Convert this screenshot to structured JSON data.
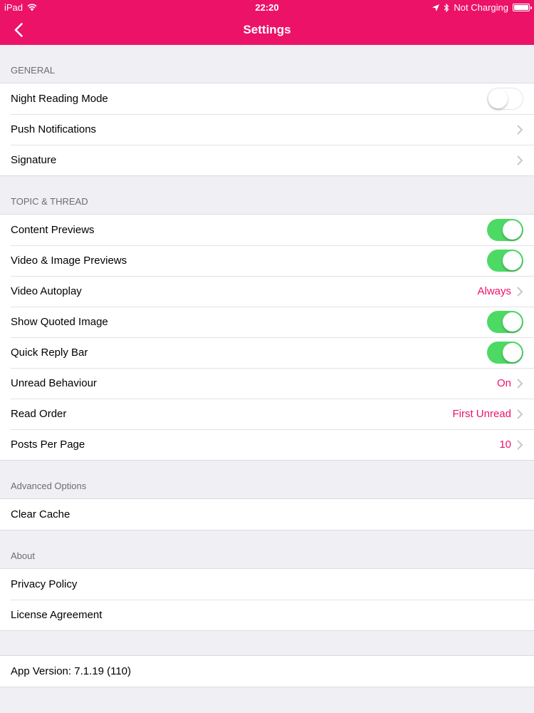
{
  "status_bar": {
    "device": "iPad",
    "time": "22:20",
    "charging": "Not Charging"
  },
  "nav": {
    "title": "Settings"
  },
  "colors": {
    "brand": "#ec1268",
    "toggle_on": "#4cd964"
  },
  "sections": {
    "general": {
      "header": "GENERAL",
      "rows": {
        "night_reading": {
          "label": "Night Reading Mode",
          "toggle": "off"
        },
        "push": {
          "label": "Push Notifications"
        },
        "signature": {
          "label": "Signature"
        }
      }
    },
    "topic": {
      "header": "TOPIC & THREAD",
      "rows": {
        "content_previews": {
          "label": "Content Previews",
          "toggle": "on"
        },
        "video_image_previews": {
          "label": "Video & Image Previews",
          "toggle": "on"
        },
        "video_autoplay": {
          "label": "Video Autoplay",
          "value": "Always"
        },
        "show_quoted_image": {
          "label": "Show Quoted Image",
          "toggle": "on"
        },
        "quick_reply_bar": {
          "label": "Quick Reply Bar",
          "toggle": "on"
        },
        "unread_behaviour": {
          "label": "Unread Behaviour",
          "value": "On"
        },
        "read_order": {
          "label": "Read Order",
          "value": "First Unread"
        },
        "posts_per_page": {
          "label": "Posts Per Page",
          "value": "10"
        }
      }
    },
    "advanced": {
      "header": "Advanced Options",
      "rows": {
        "clear_cache": {
          "label": "Clear Cache"
        }
      }
    },
    "about": {
      "header": "About",
      "rows": {
        "privacy": {
          "label": "Privacy Policy"
        },
        "license": {
          "label": "License Agreement"
        }
      }
    },
    "version": {
      "label": "App Version: 7.1.19 (110)"
    }
  }
}
